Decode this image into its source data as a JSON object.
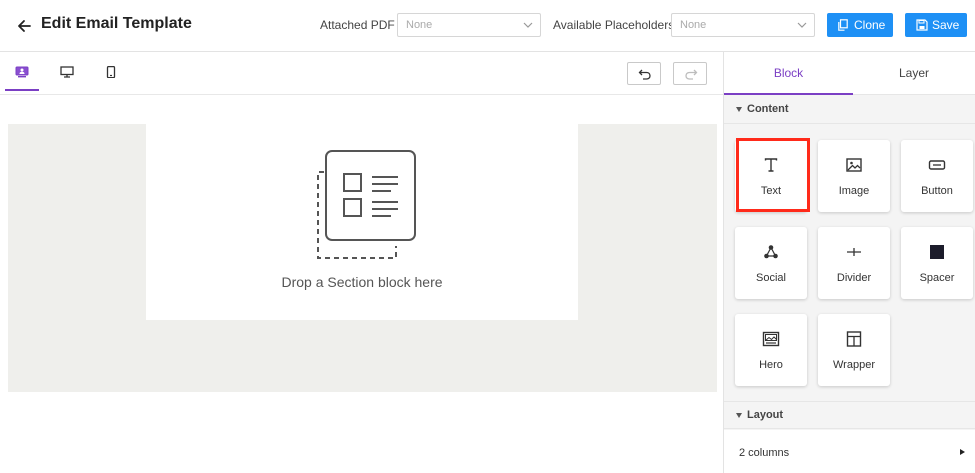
{
  "header": {
    "title": "Edit Email Template",
    "attached_pdf_label": "Attached PDF",
    "attached_pdf_value": "None",
    "placeholders_label": "Available Placeholders",
    "placeholders_value": "None",
    "clone_label": "Clone",
    "save_label": "Save"
  },
  "toolbar": {
    "device_tabs": [
      {
        "icon": "personal-device-icon",
        "active": true
      },
      {
        "icon": "desktop-icon",
        "active": false
      },
      {
        "icon": "mobile-icon",
        "active": false
      }
    ],
    "undo_icon": "undo-icon",
    "redo_icon": "redo-icon"
  },
  "canvas": {
    "drop_text": "Drop a Section block here",
    "canvas_bg": "#efefec"
  },
  "panel": {
    "tabs": [
      "Block",
      "Layer"
    ],
    "active_tab": "Block",
    "content_section": "Content",
    "blocks": [
      {
        "label": "Text",
        "icon": "text-icon"
      },
      {
        "label": "Image",
        "icon": "image-icon"
      },
      {
        "label": "Button",
        "icon": "button-icon"
      },
      {
        "label": "Social",
        "icon": "social-icon"
      },
      {
        "label": "Divider",
        "icon": "divider-icon"
      },
      {
        "label": "Spacer",
        "icon": "spacer-icon"
      },
      {
        "label": "Hero",
        "icon": "hero-icon"
      },
      {
        "label": "Wrapper",
        "icon": "wrapper-icon"
      }
    ],
    "layout_section": "Layout",
    "layout_items": [
      "2 columns"
    ]
  },
  "colors": {
    "accent": "#7b3fc4",
    "primary_button": "#1e90f5",
    "highlight": "#ff2a1a"
  }
}
